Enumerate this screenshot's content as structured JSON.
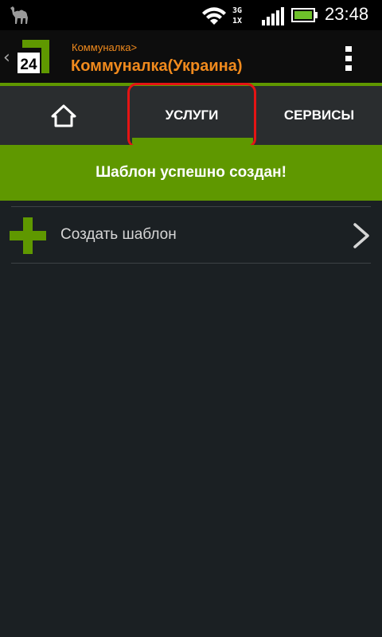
{
  "status_bar": {
    "app_icon": "camel-icon",
    "network_top": "3G",
    "network_bottom": "1X",
    "clock": "23:48"
  },
  "action_bar": {
    "logo_text": "24",
    "breadcrumb": "Коммуналка>",
    "title": "Коммуналка(Украина)",
    "accent_color": "#f08a1d",
    "brand_color": "#5f9800"
  },
  "tabs": [
    {
      "label": "",
      "icon": "home-icon"
    },
    {
      "label": "УСЛУГИ"
    },
    {
      "label": "СЕРВИСЫ"
    }
  ],
  "banner": {
    "text": "Шаблон успешно создан!"
  },
  "list": {
    "items": [
      {
        "label": "Создать шаблон",
        "icon": "plus-icon",
        "trailing_icon": "chevron-right-icon"
      }
    ]
  }
}
